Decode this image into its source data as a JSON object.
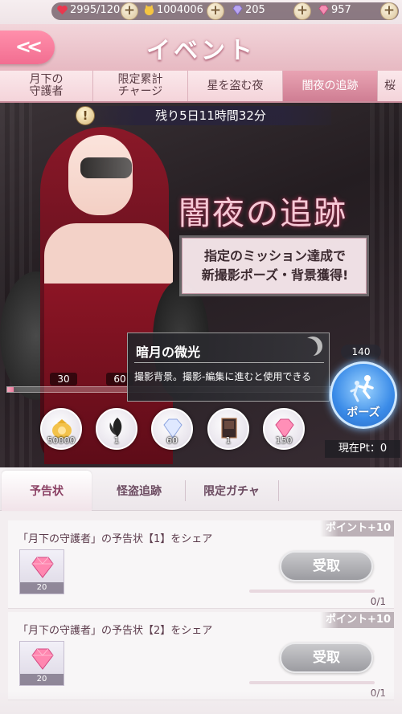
{
  "resources": {
    "stamina": "2995/120",
    "gold": "1004006",
    "diamonds": "205",
    "pink_diamonds": "957"
  },
  "header": {
    "title": "イベント",
    "back_label": "<<"
  },
  "event_tabs": [
    {
      "label": "月下の\n守護者",
      "active": false
    },
    {
      "label": "限定累計\nチャージ",
      "active": false
    },
    {
      "label": "星を盗む夜",
      "active": false
    },
    {
      "label": "闇夜の追跡",
      "active": true
    },
    {
      "label": "桜",
      "active": false
    }
  ],
  "banner": {
    "timer": "残り5日11時間32分",
    "info_icon_label": "!",
    "event_title": "闇夜の追跡",
    "event_desc_line1": "指定のミッション達成で",
    "event_desc_line2": "新撮影ポーズ・背景獲得!",
    "popup_title": "暗月の微光",
    "popup_text": "撮影背景。撮影-編集に進むと使用できる",
    "tier_labels": [
      "30",
      "60"
    ],
    "progress_fraction": 0.02,
    "rewards": [
      {
        "name": "gold",
        "count": "50000"
      },
      {
        "name": "feather-headpiece",
        "count": "1"
      },
      {
        "name": "diamond",
        "count": "60"
      },
      {
        "name": "background-card",
        "count": "1"
      },
      {
        "name": "pink-diamond",
        "count": "150"
      }
    ],
    "pose_points": "140",
    "pose_label": "ポーズ",
    "current_points": "現在Pt：0"
  },
  "sub_tabs": [
    {
      "label": "予告状",
      "active": true
    },
    {
      "label": "怪盗追跡",
      "active": false
    },
    {
      "label": "限定ガチャ",
      "active": false
    }
  ],
  "missions": [
    {
      "title": "「月下の守護者」の予告状【1】をシェア",
      "points": "ポイント+10",
      "item_count": "20",
      "claim_label": "受取",
      "progress": "0/1"
    },
    {
      "title": "「月下の守護者」の予告状【2】をシェア",
      "points": "ポイント+10",
      "item_count": "20",
      "claim_label": "受取",
      "progress": "0/1"
    }
  ],
  "colors": {
    "accent_pink": "#f26e91",
    "pose_blue": "#3a8be8",
    "claim_gray": "#9c9ca1"
  }
}
